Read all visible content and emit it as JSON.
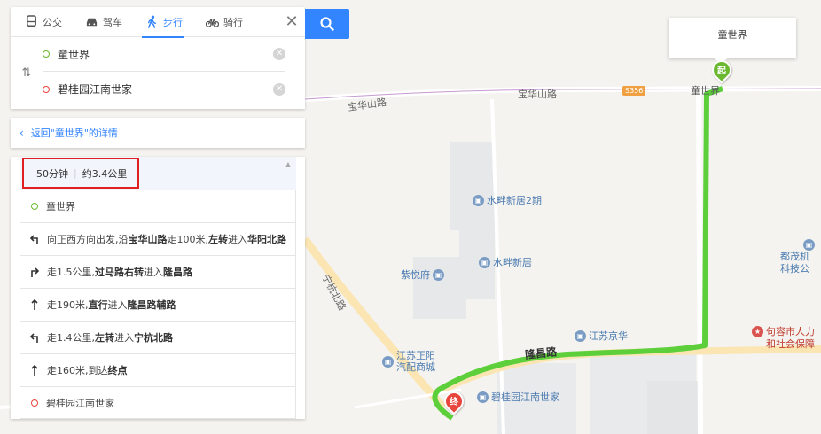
{
  "modes": [
    {
      "label": "公交",
      "icon": "bus-icon"
    },
    {
      "label": "驾车",
      "icon": "car-icon"
    },
    {
      "label": "步行",
      "icon": "walk-icon",
      "active": true
    },
    {
      "label": "骑行",
      "icon": "bike-icon"
    }
  ],
  "route": {
    "start": "童世界",
    "end": "碧桂园江南世家"
  },
  "back_link": "返回\"童世界\"的详情",
  "summary": {
    "time": "50分钟",
    "distance": "约3.4公里"
  },
  "steps": {
    "start": "童世界",
    "s1": {
      "a": "向正西方向出发,沿",
      "b": "宝华山路",
      "c": "走100米,",
      "d": "左转",
      "e": "进入",
      "f": "华阳北路"
    },
    "s2": {
      "a": "走1.5公里,",
      "b": "过马路右转",
      "c": "进入",
      "d": "隆昌路"
    },
    "s3": {
      "a": "走190米,",
      "b": "直行",
      "c": "进入",
      "d": "隆昌路辅路"
    },
    "s4": {
      "a": "走1.4公里,",
      "b": "左转",
      "c": "进入",
      "d": "宁杭北路"
    },
    "s5": {
      "a": "走160米,到达",
      "b": "终点"
    },
    "end": "碧桂园江南世家"
  },
  "map": {
    "callout": "童世界",
    "start_marker": "起",
    "end_marker": "终",
    "labels": {
      "baohua1": "宝华山路",
      "baohua2": "宝华山路",
      "shield": "S356",
      "tongshijie": "童世界",
      "ninghang": "宁杭北路",
      "longchang": "隆昌路",
      "shuipan2": "水畔新居2期",
      "shuipan": "水畔新居",
      "ziyue": "紫悦府",
      "jiangsujinghua": "江苏京华",
      "zhengyang1": "江苏正阳",
      "zhengyang2": "汽配商城",
      "bigui": "碧桂园江南世家",
      "doumao1": "都茂机",
      "doumao2": "科技公",
      "jurong1": "句容市人力",
      "jurong2": "和社会保障"
    }
  }
}
